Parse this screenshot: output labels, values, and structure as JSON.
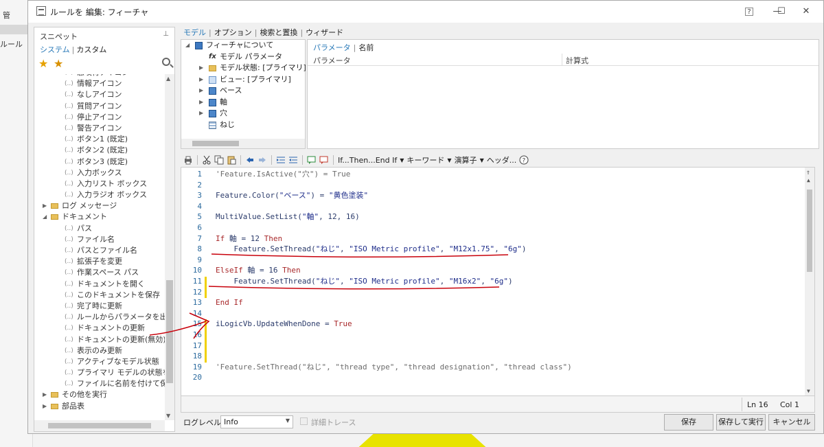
{
  "app": {
    "title": "ルールを 編集: フィーチャ",
    "bg_left": {
      "kan": "管",
      "rule": "ルール"
    }
  },
  "window_controls": {
    "help": "?",
    "minimize": "—",
    "maximize": "☐",
    "close": "✕"
  },
  "snippets": {
    "header": "スニペット",
    "pin": "📌",
    "tab_system": "システム",
    "tab_custom": "カスタム",
    "items_top": [
      "感嘆符アイコン",
      "情報アイコン",
      "なしアイコン",
      "質問アイコン",
      "停止アイコン",
      "警告アイコン",
      "ボタン1 (既定)",
      "ボタン2 (既定)",
      "ボタン3 (既定)",
      "入力ボックス",
      "入力リスト ボックス",
      "入力ラジオ ボックス"
    ],
    "folder_log": "ログ メッセージ",
    "folder_doc": "ドキュメント",
    "items_doc": [
      "パス",
      "ファイル名",
      "パスとファイル名",
      "拡張子を変更",
      "作業スペース パス",
      "ドキュメントを開く",
      "このドキュメントを保存",
      "完了時に更新",
      "ルールからパラメータを出力",
      "ドキュメントの更新",
      "ドキュメントの更新(無効)",
      "表示のみ更新",
      "アクティブなモデル状態",
      "プライマリ モデルの状態をアクティ",
      "ファイルに名前を付けて保存"
    ],
    "folder_other": "その他を実行",
    "folder_parts": "部品表"
  },
  "top_tabs": [
    "モデル",
    "オプション",
    "検索と置換",
    "ウィザード"
  ],
  "model_tree": {
    "root": "フィーチャについて",
    "items": [
      {
        "label": "モデル パラメータ",
        "icon": "fx-icon"
      },
      {
        "label": "モデル状態: [プライマリ]",
        "icon": "folder-icon"
      },
      {
        "label": "ビュー: [プライマリ]",
        "icon": "view-icon"
      },
      {
        "label": "ベース",
        "icon": "body-icon"
      },
      {
        "label": "軸",
        "icon": "body-icon"
      },
      {
        "label": "穴",
        "icon": "body-icon"
      },
      {
        "label": "ねじ",
        "icon": "thread-icon"
      }
    ]
  },
  "param": {
    "tab_param": "パラメータ",
    "tab_name": "名前",
    "col_param": "パラメータ",
    "col_formula": "計算式"
  },
  "toolbar": {
    "ifthen": "If...Then...End If",
    "keyword": "キーワード",
    "operator": "演算子",
    "header": "ヘッダ..."
  },
  "code": [
    {
      "n": "1",
      "parts": [
        {
          "t": "'Feature.IsActive(\"穴\") = True",
          "c": "cm"
        }
      ]
    },
    {
      "n": "2",
      "parts": []
    },
    {
      "n": "3",
      "parts": [
        {
          "t": "Feature.Color(",
          "c": "obj"
        },
        {
          "t": "\"ベース\"",
          "c": "str"
        },
        {
          "t": ") = ",
          "c": "obj"
        },
        {
          "t": "\"黄色塗装\"",
          "c": "str"
        }
      ]
    },
    {
      "n": "4",
      "parts": []
    },
    {
      "n": "5",
      "parts": [
        {
          "t": "MultiValue.SetList(",
          "c": "obj"
        },
        {
          "t": "\"軸\"",
          "c": "str"
        },
        {
          "t": ", 12, 16)",
          "c": "obj"
        }
      ]
    },
    {
      "n": "6",
      "parts": []
    },
    {
      "n": "7",
      "parts": [
        {
          "t": "If ",
          "c": "kw"
        },
        {
          "t": "軸 = 12 ",
          "c": "obj"
        },
        {
          "t": "Then",
          "c": "kw"
        }
      ]
    },
    {
      "n": "8",
      "parts": [
        {
          "t": "    Feature.SetThread(",
          "c": "obj"
        },
        {
          "t": "\"ねじ\"",
          "c": "str"
        },
        {
          "t": ", ",
          "c": "obj"
        },
        {
          "t": "\"ISO Metric profile\"",
          "c": "str"
        },
        {
          "t": ", ",
          "c": "obj"
        },
        {
          "t": "\"M12x1.75\"",
          "c": "str"
        },
        {
          "t": ", ",
          "c": "obj"
        },
        {
          "t": "\"6g\"",
          "c": "str"
        },
        {
          "t": ")",
          "c": "obj"
        }
      ]
    },
    {
      "n": "9",
      "parts": []
    },
    {
      "n": "10",
      "parts": [
        {
          "t": "ElseIf ",
          "c": "kw"
        },
        {
          "t": "軸 = 16 ",
          "c": "obj"
        },
        {
          "t": "Then",
          "c": "kw"
        }
      ]
    },
    {
      "n": "11",
      "parts": [
        {
          "t": "    Feature.SetThread(",
          "c": "obj"
        },
        {
          "t": "\"ねじ\"",
          "c": "str"
        },
        {
          "t": ", ",
          "c": "obj"
        },
        {
          "t": "\"ISO Metric profile\"",
          "c": "str"
        },
        {
          "t": ", ",
          "c": "obj"
        },
        {
          "t": "\"M16x2\"",
          "c": "str"
        },
        {
          "t": ", ",
          "c": "obj"
        },
        {
          "t": "\"6g\"",
          "c": "str"
        },
        {
          "t": ")",
          "c": "obj"
        }
      ]
    },
    {
      "n": "12",
      "parts": []
    },
    {
      "n": "13",
      "parts": [
        {
          "t": "End If",
          "c": "kw"
        }
      ]
    },
    {
      "n": "14",
      "parts": []
    },
    {
      "n": "15",
      "parts": [
        {
          "t": "iLogicVb.UpdateWhenDone = ",
          "c": "obj"
        },
        {
          "t": "True",
          "c": "kw"
        }
      ]
    },
    {
      "n": "16",
      "parts": []
    },
    {
      "n": "17",
      "parts": []
    },
    {
      "n": "18",
      "parts": []
    },
    {
      "n": "19",
      "parts": [
        {
          "t": "'Feature.SetThread(\"ねじ\", \"thread type\", \"thread designation\", \"thread class\")",
          "c": "cm"
        }
      ]
    },
    {
      "n": "20",
      "parts": []
    }
  ],
  "status": {
    "line": "Ln 16",
    "col": "Col 1"
  },
  "bottom": {
    "log_label": "ログレベル",
    "log_value": "Info",
    "trace_label": "詳細トレース",
    "save": "保存",
    "save_run": "保存して実行",
    "cancel": "キャンセル"
  },
  "colors": {
    "accent": "#2a7ab8",
    "keyword": "#a8282a",
    "annotation": "#c8000a"
  }
}
